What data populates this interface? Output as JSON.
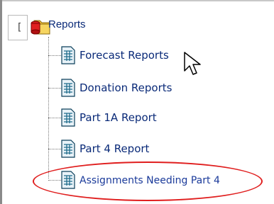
{
  "tree": {
    "toggle_glyph": "[",
    "root": {
      "label": "Reports",
      "icon": "folder-with-red-marker-icon"
    },
    "items": [
      {
        "label": "Forecast Reports",
        "icon": "report-document-icon"
      },
      {
        "label": "Donation Reports",
        "icon": "report-document-icon"
      },
      {
        "label": "Part 1A Report",
        "icon": "report-document-icon"
      },
      {
        "label": "Part 4 Report",
        "icon": "report-document-icon"
      },
      {
        "label": "Assignments Needing Part 4",
        "icon": "report-document-icon",
        "highlighted": true
      }
    ]
  },
  "colors": {
    "link": "#0a2a78",
    "highlight": "#e01e1e"
  },
  "cursor": "arrow-cursor-icon"
}
